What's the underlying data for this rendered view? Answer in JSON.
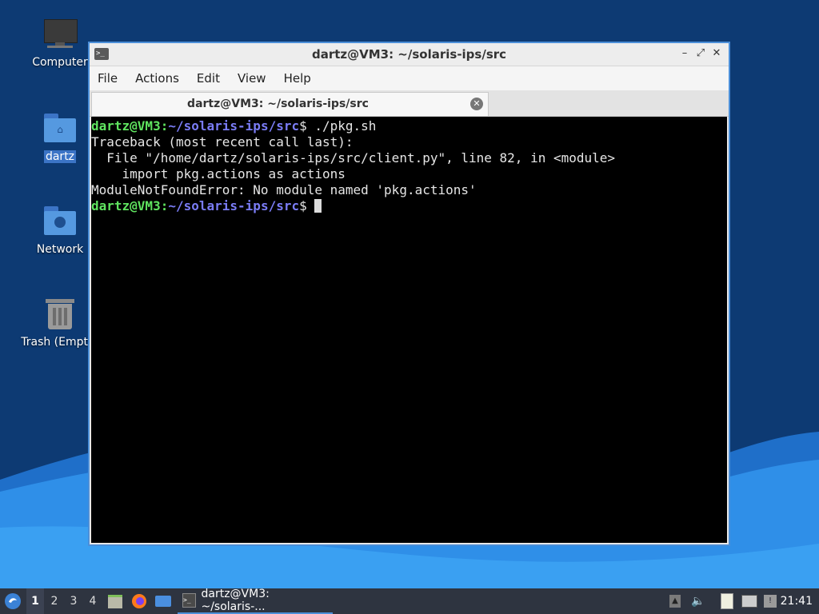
{
  "desktop": {
    "icons": [
      {
        "label": "Computer"
      },
      {
        "label": "dartz"
      },
      {
        "label": "Network"
      },
      {
        "label": "Trash (Empty)"
      }
    ],
    "colors": {
      "wallpaper_dark": "#0d3a73",
      "wallpaper_light": "#2f8fe8"
    }
  },
  "window": {
    "title": "dartz@VM3: ~/solaris-ips/src",
    "buttons": {
      "minimize": "–",
      "maximize": "⤢",
      "close": "✕"
    },
    "menu": [
      "File",
      "Actions",
      "Edit",
      "View",
      "Help"
    ],
    "tab": {
      "title": "dartz@VM3: ~/solaris-ips/src",
      "close": "✕"
    }
  },
  "terminal": {
    "prompt_user": "dartz@VM3",
    "prompt_sep": ":",
    "prompt_path": "~/solaris-ips/src",
    "prompt_symbol": "$ ",
    "command": "./pkg.sh",
    "output": [
      "Traceback (most recent call last):",
      "  File \"/home/dartz/solaris-ips/src/client.py\", line 82, in <module>",
      "    import pkg.actions as actions",
      "ModuleNotFoundError: No module named 'pkg.actions'"
    ],
    "colors": {
      "user": "#5fe35f",
      "path": "#7a7cf5",
      "text": "#e6e6e6",
      "background": "#000000"
    }
  },
  "taskbar": {
    "workspaces": [
      "1",
      "2",
      "3",
      "4"
    ],
    "active_workspace": "1",
    "task_label": "dartz@VM3: ~/solaris-...",
    "clock": "21:41",
    "icons": [
      "start-menu-icon",
      "file-manager-icon",
      "firefox-icon",
      "show-desktop-icon",
      "terminal-icon",
      "eject-icon",
      "volume-icon",
      "clipboard-icon",
      "network-icon",
      "update-notifier-icon"
    ]
  }
}
